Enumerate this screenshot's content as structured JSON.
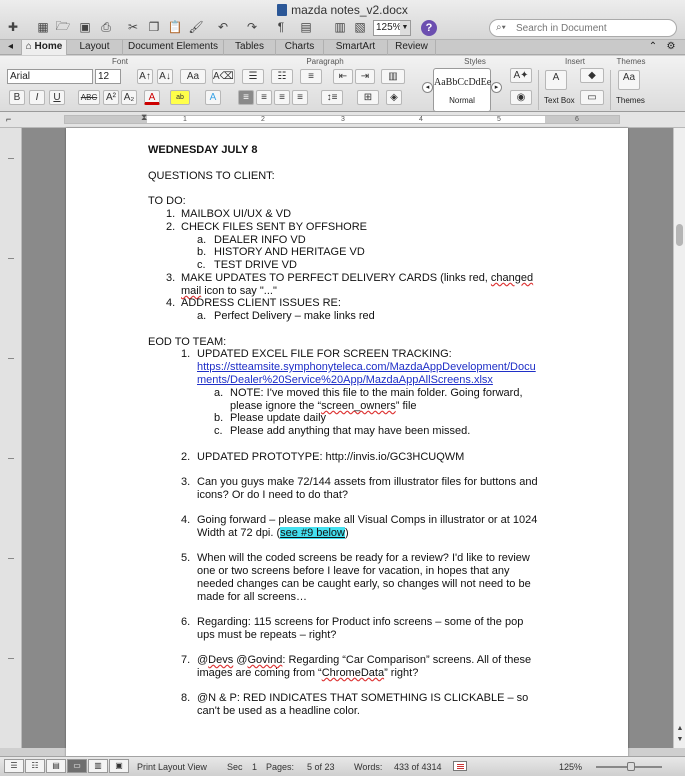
{
  "window": {
    "title": "mazda notes_v2.docx",
    "zoom": "125%",
    "search_placeholder": "Search in Document",
    "help_label": "?"
  },
  "ribbon_tabs": [
    {
      "label": "Home",
      "active": true
    },
    {
      "label": "Layout"
    },
    {
      "label": "Document Elements"
    },
    {
      "label": "Tables"
    },
    {
      "label": "Charts"
    },
    {
      "label": "SmartArt"
    },
    {
      "label": "Review"
    }
  ],
  "ribbon": {
    "groups": {
      "font": "Font",
      "paragraph": "Paragraph",
      "styles": "Styles",
      "insert": "Insert",
      "themes": "Themes"
    },
    "font_name": "Arial",
    "font_size": "12",
    "style_sample": "AaBbCcDdEe",
    "style_name": "Normal",
    "text_box_label": "Text Box",
    "themes_label": "Themes",
    "format_buttons": [
      "B",
      "I",
      "U",
      "ABC",
      "A²",
      "A₂"
    ]
  },
  "ruler": {
    "numbers": [
      "1",
      "2",
      "3",
      "4",
      "5",
      "6"
    ]
  },
  "document": {
    "heading": "WEDNESDAY JULY 8",
    "questions": "QUESTIONS TO CLIENT:",
    "todo": "TO DO:",
    "todo_items": [
      {
        "num": "1.",
        "text": "MAILBOX UI/UX & VD"
      },
      {
        "num": "2.",
        "text": "CHECK FILES SENT BY OFFSHORE"
      },
      {
        "num": "a.",
        "text": "DEALER INFO VD"
      },
      {
        "num": "b.",
        "text": "HISTORY AND HERITAGE VD"
      },
      {
        "num": "c.",
        "text": "TEST DRIVE VD"
      },
      {
        "num": "3.",
        "text_a": "MAKE UPDATES TO PERFECT DELIVERY CARDS (links red, ",
        "text_b": "changed",
        "text_c": "mail",
        "text_d": " icon to say \"...\""
      },
      {
        "num": "4.",
        "text": "ADDRESS CLIENT ISSUES RE:"
      },
      {
        "num": "a.",
        "text": "Perfect Delivery – make links red"
      }
    ],
    "eod": "EOD TO TEAM:",
    "eod_items": {
      "i1": {
        "num": "1.",
        "text": "UPDATED EXCEL FILE FOR SCREEN TRACKING:"
      },
      "link1": "https://stteamsite.symphonyteleca.com/MazdaAppDevelopment/Docu",
      "link2": "ments/Dealer%20Service%20App/MazdaAppAllScreens.xlsx",
      "a1_num": "a.",
      "a1_l1": "NOTE: I've moved this file to the main folder. Going forward,",
      "a1_l2a": "please ignore the “",
      "a1_l2b": "screen_owners",
      "a1_l2c": "” file",
      "b1_num": "b.",
      "b1": "Please update daily",
      "c1_num": "c.",
      "c1": "Please add anything that may have been missed.",
      "i2_num": "2.",
      "i2": "UPDATED PROTOTYPE: http://invis.io/GC3HCUQWM",
      "i3_num": "3.",
      "i3_l1": "Can you guys make 72/144 assets from illustrator files for buttons and",
      "i3_l2": "icons? Or do I need to do that?",
      "i4_num": "4.",
      "i4_l1": "Going forward – please make all Visual Comps in illustrator or at 1024",
      "i4_l2a": "Width at 72 dpi. (",
      "i4_l2b": "see #9 below",
      "i4_l2c": ")",
      "i5_num": "5.",
      "i5_l1": "When will the coded screens be ready for a review? I'd like to review",
      "i5_l2": "one or two screens before I leave for vacation, in hopes that any",
      "i5_l3": "needed changes can be caught early, so changes will not need to be",
      "i5_l4": "made for all screens…",
      "i6_num": "6.",
      "i6_l1": "Regarding: 115 screens for Product info screens – some of the pop",
      "i6_l2": "ups must be repeats – right?",
      "i7_num": "7.",
      "i7_l1a": "@",
      "i7_l1b": "Devs",
      "i7_l1c": " @",
      "i7_l1d": "Govind",
      "i7_l1e": ": Regarding “Car Comparison” screens. All of these",
      "i7_l2a": "images are coming from “",
      "i7_l2b": "ChromeData",
      "i7_l2c": "” right?",
      "i8_num": "8.",
      "i8_l1": " @N & P: RED INDICATES THAT SOMETHING IS CLICKABLE – so",
      "i8_l2": "can't be used as a headline color."
    }
  },
  "status_bar": {
    "view": "Print Layout View",
    "sec_label": "Sec",
    "sec_value": "1",
    "pages_label": "Pages:",
    "pages_value": "5 of 23",
    "words_label": "Words:",
    "words_value": "433 of 4314",
    "zoom": "125%"
  }
}
